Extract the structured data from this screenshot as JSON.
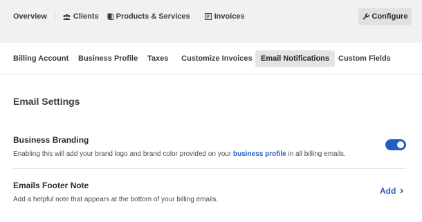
{
  "top_nav": {
    "items": [
      {
        "label": "Overview",
        "icon": ""
      },
      {
        "label": "Clients",
        "icon": "users-icon"
      },
      {
        "label": "Products & Services",
        "icon": "document-icon"
      },
      {
        "label": "Invoices",
        "icon": "invoice-icon"
      }
    ],
    "configure_label": "Configure",
    "configure_icon": "wrench-icon"
  },
  "tabs": [
    {
      "label": "Billing Account",
      "active": false
    },
    {
      "label": "Business Profile",
      "active": false
    },
    {
      "label": "Taxes",
      "active": false
    },
    {
      "label": "Customize Invoices",
      "active": false
    },
    {
      "label": "Email Notifications",
      "active": true
    },
    {
      "label": "Custom Fields",
      "active": false
    }
  ],
  "main": {
    "section_title": "Email Settings",
    "settings": [
      {
        "title": "Business Branding",
        "description_before": "Enabling this will add your brand logo and brand color provided on your ",
        "description_link": "business profile",
        "description_after": " in all billing emails.",
        "toggle_on": true
      },
      {
        "title": "Emails Footer Note",
        "description": "Add a helpful note that appears at the bottom of your billing emails.",
        "action_label": "Add"
      }
    ]
  },
  "colors": {
    "accent": "#1f5fc1",
    "topbar_bg": "#f1f1f1",
    "active_tab_bg": "#e4e4e4"
  }
}
